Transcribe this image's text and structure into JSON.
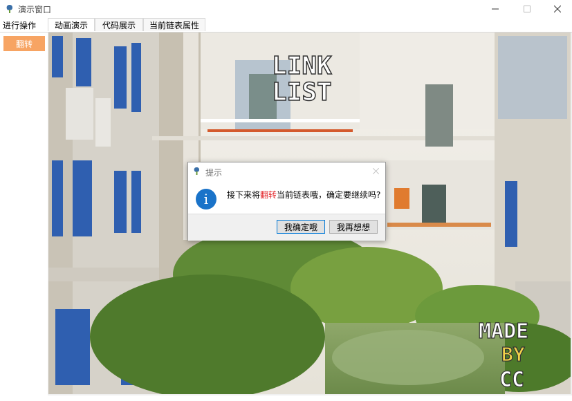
{
  "window": {
    "title": "演示窗口",
    "app_icon": "app-icon",
    "controls": [
      "minimize-icon",
      "maximize-icon",
      "close-icon"
    ]
  },
  "left_panel": {
    "tab_label": "进行操作",
    "reverse_button": "翻转",
    "accent_color": "#f7a463"
  },
  "tabs": [
    {
      "label": "动画演示"
    },
    {
      "label": "代码展示"
    },
    {
      "label": "当前链表属性"
    }
  ],
  "scene": {
    "logo_text": [
      "LINK",
      "LIST"
    ],
    "signature_text": [
      "MADE",
      "BY",
      "CC"
    ]
  },
  "dialog": {
    "title": "提示",
    "icon": "info-icon",
    "message_prefix": "接下来将",
    "message_highlight": "翻转",
    "message_suffix": "当前链表哦，确定要继续吗?",
    "highlight_color": "#e3262a",
    "confirm_button": "我确定哦",
    "cancel_button": "我再想想"
  }
}
